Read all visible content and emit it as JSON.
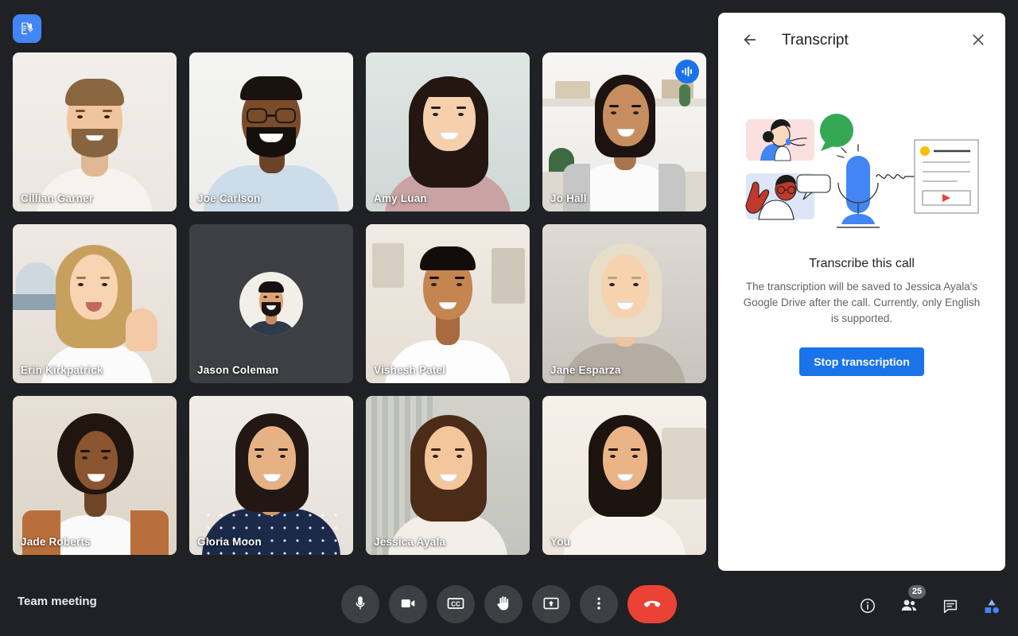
{
  "app": {
    "meeting_title": "Team meeting",
    "status_chip_icon": "transcription-active-icon",
    "background_color": "#202124",
    "accent_color": "#1a73e8"
  },
  "grid": {
    "tiles": [
      {
        "name": "Cillian Garner",
        "type": "video",
        "speaking": false,
        "active": false
      },
      {
        "name": "Joe Carlson",
        "type": "video",
        "speaking": false,
        "active": false
      },
      {
        "name": "Amy Luan",
        "type": "video",
        "speaking": false,
        "active": false
      },
      {
        "name": "Jo Hall",
        "type": "video",
        "speaking": true,
        "active": true
      },
      {
        "name": "Erin Kirkpatrick",
        "type": "video",
        "speaking": false,
        "active": false
      },
      {
        "name": "Jason Coleman",
        "type": "avatar",
        "speaking": false,
        "active": false
      },
      {
        "name": "Vishesh Patel",
        "type": "video",
        "speaking": false,
        "active": false
      },
      {
        "name": "Jane Esparza",
        "type": "video",
        "speaking": false,
        "active": false
      },
      {
        "name": "Jade Roberts",
        "type": "video",
        "speaking": false,
        "active": false
      },
      {
        "name": "Gloria Moon",
        "type": "video",
        "speaking": false,
        "active": false
      },
      {
        "name": "Jessica Ayala",
        "type": "video",
        "speaking": false,
        "active": false
      },
      {
        "name": "You",
        "type": "video",
        "speaking": false,
        "active": false
      }
    ]
  },
  "panel": {
    "title": "Transcript",
    "back_icon": "arrow-left-icon",
    "close_icon": "close-icon",
    "illustration": "transcription-illustration",
    "heading": "Transcribe this call",
    "description": "The transcription will be saved to Jessica Ayala's Google Drive after the call. Currently, only English is supported.",
    "button_label": "Stop transcription"
  },
  "controls": {
    "center": [
      {
        "name": "microphone-button",
        "icon": "microphone-icon",
        "label": "Turn off microphone",
        "style": "default"
      },
      {
        "name": "camera-button",
        "icon": "video-camera-icon",
        "label": "Turn off camera",
        "style": "default"
      },
      {
        "name": "captions-button",
        "icon": "closed-captions-icon",
        "label": "Turn on captions",
        "style": "default"
      },
      {
        "name": "raise-hand-button",
        "icon": "raised-hand-icon",
        "label": "Raise hand",
        "style": "default"
      },
      {
        "name": "present-button",
        "icon": "present-screen-icon",
        "label": "Present now",
        "style": "default"
      },
      {
        "name": "more-options-button",
        "icon": "more-vertical-icon",
        "label": "More options",
        "style": "default"
      },
      {
        "name": "leave-call-button",
        "icon": "phone-hangup-icon",
        "label": "Leave call",
        "style": "hangup"
      }
    ],
    "right": [
      {
        "name": "meeting-details-button",
        "icon": "info-icon",
        "label": "Meeting details",
        "badge": ""
      },
      {
        "name": "participants-button",
        "icon": "people-icon",
        "label": "Show everyone",
        "badge": "25"
      },
      {
        "name": "chat-button",
        "icon": "chat-bubble-icon",
        "label": "Chat with everyone",
        "badge": ""
      },
      {
        "name": "activities-button",
        "icon": "activities-shapes-icon",
        "label": "Activities",
        "badge": ""
      }
    ]
  }
}
